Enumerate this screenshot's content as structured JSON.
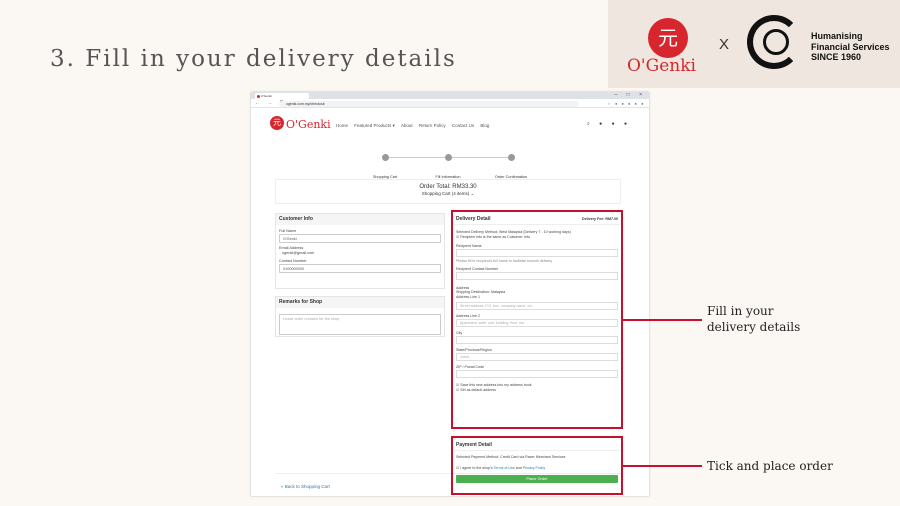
{
  "slide": {
    "title": "3. Fill in your delivery details",
    "brand_left": "O'Genki",
    "brand_left_glyph": "元",
    "separator": "X",
    "tagline": [
      "Humanising",
      "Financial Services",
      "SINCE 1960"
    ]
  },
  "browser": {
    "tab_title": "O'Genki",
    "url": "ogenki.com.my/checkout",
    "nav_glyphs": "← → C",
    "ext_glyphs": "☆ ● ● ● ● ●",
    "window_glyphs": "– □ ×"
  },
  "site": {
    "logo_glyph": "元",
    "logo": "O'Genki",
    "menu": [
      "Home",
      "Featured Products ▾",
      "About",
      "Return Policy",
      "Contact Us",
      "Blog"
    ],
    "nav_icons": "⌕ ● ● ●"
  },
  "steps": [
    "Shopping Cart",
    "Fill Information",
    "Order Confirmation"
  ],
  "order": {
    "total": "Order Total: RM33.30",
    "items": "Shopping Cart (4 items)  ⌄"
  },
  "customer": {
    "heading": "Customer Info",
    "full_name_label": "Full Name",
    "full_name_value": "O'Genki",
    "email_label": "Email Address",
    "email_value": "ogenki@gmail.com",
    "contact_label": "Contact Number",
    "contact_value": "0100000000"
  },
  "remarks": {
    "heading": "Remarks for Shop",
    "placeholder": "Leave order remarks for the shop"
  },
  "delivery": {
    "heading": "Delivery Detail",
    "fee": "Delivery Fee: RM7.00",
    "method": "Selected Delivery Method: West Malaysia (Delivery 7 - 10 working days)",
    "same_as_customer": "☑ Recipient info is the same as Customer Info",
    "recipient_name_label": "Recipient Name",
    "recipient_name_hint": "Please fill in recipient's full name to facilitate smooth delivery",
    "recipient_contact_label": "Recipient Contact Number",
    "address_label": "Address",
    "destination": "Shipping Destination: Malaysia",
    "line1_label": "Address Line 1",
    "line1_placeholder": "Street address, P.O. box, company name, c/o",
    "line2_label": "Address Line 2",
    "line2_placeholder": "Apartment, suite, unit, building, floor, etc.",
    "city_label": "City",
    "state_label": "State/Province/Region",
    "state_value": "Johor",
    "zip_label": "ZIP / Postal Code",
    "save_address": "☑ Save this new address into my address book",
    "set_default": "☑ Set as default address"
  },
  "payment": {
    "heading": "Payment Detail",
    "method": "Selected Payment Method: Credit Card via Razer Merchant Services",
    "agree_prefix": "☑ I agree to the shop's ",
    "agree_terms": "Terms of Use",
    "agree_and": " and ",
    "agree_privacy": "Privacy Policy",
    "place_order": "Place Order"
  },
  "back_link": "« Back to Shopping Cart",
  "callouts": {
    "delivery": [
      "Fill in your",
      "delivery details"
    ],
    "order": "Tick and place order"
  },
  "colors": {
    "brand_red": "#d7262e",
    "highlight": "#c8102e",
    "button_green": "#4caf50"
  }
}
